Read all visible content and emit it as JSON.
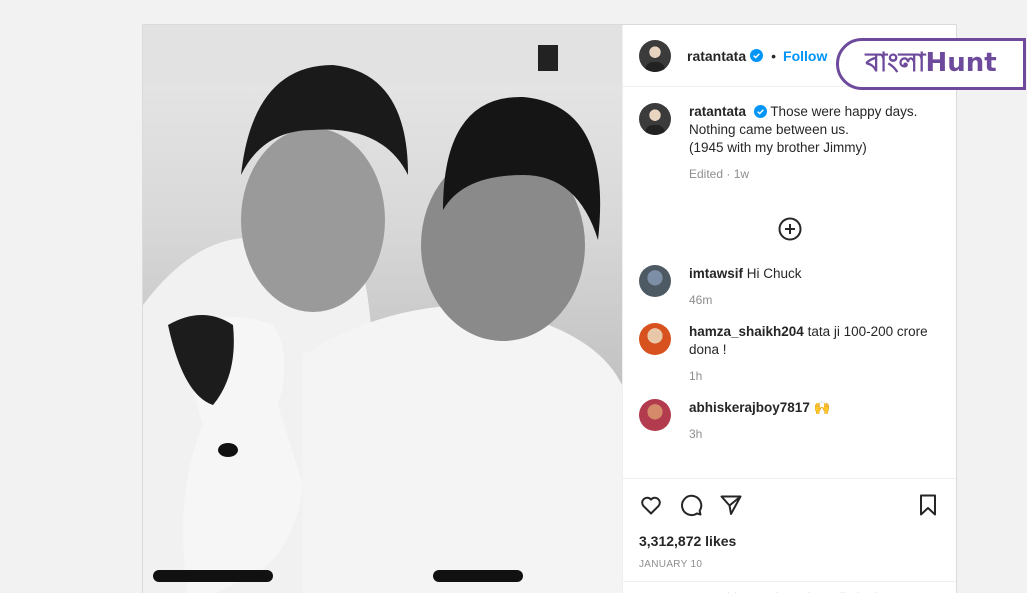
{
  "post": {
    "username": "ratantata",
    "follow_label": "Follow",
    "dot": "•",
    "caption": {
      "username": "ratantata",
      "line1": "Those were happy days.",
      "line2": "Nothing came between us.",
      "line3": "(1945 with my brother Jimmy)",
      "meta": "Edited · 1w"
    },
    "comments": [
      {
        "user": "imtawsif",
        "text": "Hi Chuck",
        "time": "46m"
      },
      {
        "user": "hamza_shaikh204",
        "text": "tata ji 100-200 crore dona !",
        "time": "1h"
      },
      {
        "user": "abhiskerajboy7817",
        "text": "🙌",
        "time": "3h"
      }
    ],
    "likes": "3,312,872 likes",
    "date": "JANUARY 10",
    "add_comment_placeholder": "Comments on this post have been limited."
  },
  "logo": {
    "text": "বাংলাHunt"
  },
  "icons": {
    "verified": "verified-badge-icon",
    "add": "plus-circle-icon",
    "like": "heart-icon",
    "comment": "comment-icon",
    "share": "send-icon",
    "save": "bookmark-icon"
  },
  "colors": {
    "accent": "#0095f6",
    "logo": "#6d4a9b"
  }
}
